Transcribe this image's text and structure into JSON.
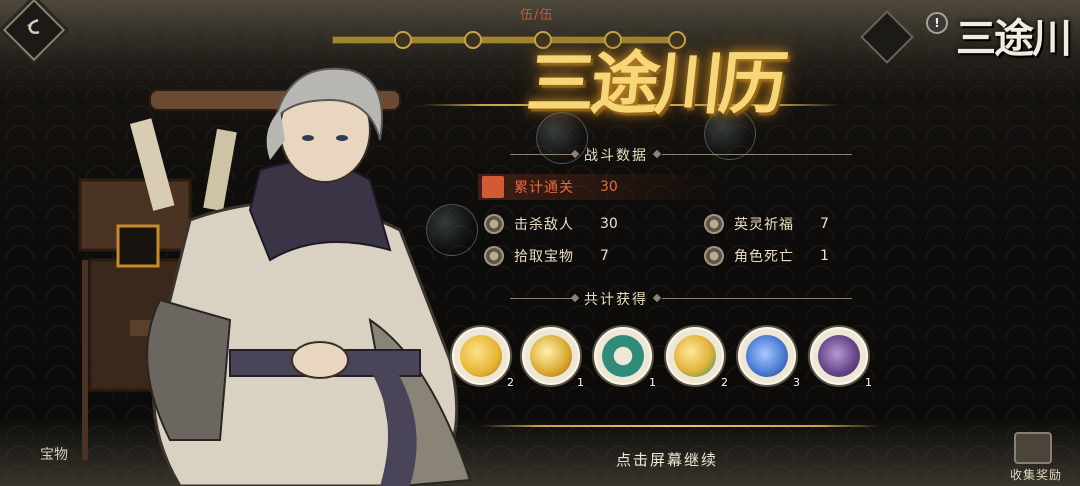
{
  "header": {
    "progress_label": "伍/伍",
    "progress_value": 1.0,
    "location_title": "三途川",
    "info_icon_text": "!"
  },
  "title": {
    "text": "三途川历"
  },
  "battle": {
    "heading": "战斗数据",
    "stats": [
      {
        "label": "累计通关",
        "value": "30",
        "icon": "scroll-icon",
        "highlight": true
      },
      {
        "label": "击杀敌人",
        "value": "30",
        "icon": "coin-icon"
      },
      {
        "label": "英灵祈福",
        "value": "7",
        "icon": "coin-icon"
      },
      {
        "label": "拾取宝物",
        "value": "7",
        "icon": "coin-icon"
      },
      {
        "label": "角色死亡",
        "value": "1",
        "icon": "coin-icon"
      }
    ]
  },
  "rewards": {
    "heading": "共计获得",
    "items": [
      {
        "icon": "gold-ingots-icon",
        "count": "2",
        "color": "#e6b531"
      },
      {
        "icon": "gold-coin-icon",
        "count": "1",
        "color": "#d9a72b"
      },
      {
        "icon": "jade-ring-icon",
        "count": "1",
        "color": "#2f8c7a"
      },
      {
        "icon": "gold-coin-icon",
        "count": "2",
        "color": "#e3b23a"
      },
      {
        "icon": "blue-spirit-icon",
        "count": "3",
        "color": "#4f7fd6"
      },
      {
        "icon": "purple-charm-icon",
        "count": "1",
        "color": "#6a4a8e"
      }
    ]
  },
  "footer": {
    "continue_text": "点击屏幕继续",
    "treasure_label": "宝物",
    "collect_label": "收集奖励"
  },
  "colors": {
    "accent_gold": "#e8c66a",
    "highlight_red": "#e56a3e"
  }
}
